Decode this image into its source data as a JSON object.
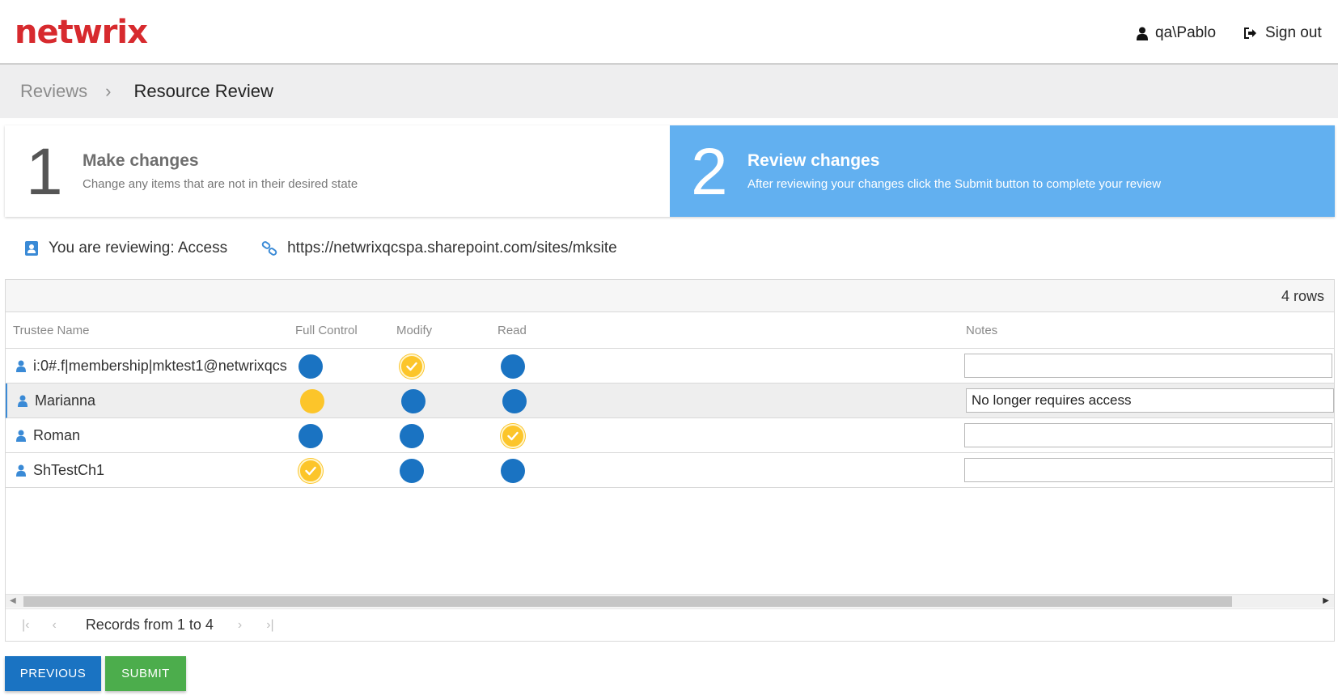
{
  "header": {
    "logo": "netwrix",
    "user": "qa\\Pablo",
    "signout": "Sign out"
  },
  "breadcrumb": {
    "parent": "Reviews",
    "current": "Resource Review"
  },
  "steps": [
    {
      "number": "1",
      "title": "Make changes",
      "description": "Change any items that are not in their desired state",
      "active": false
    },
    {
      "number": "2",
      "title": "Review changes",
      "description": "After reviewing your changes click the Submit button to complete your review",
      "active": true
    }
  ],
  "reviewing": {
    "label": "You are reviewing: Access",
    "url": "https://netwrixqcspa.sharepoint.com/sites/mksite"
  },
  "grid": {
    "rows_count": "4 rows",
    "columns": {
      "trustee": "Trustee Name",
      "full_control": "Full Control",
      "modify": "Modify",
      "read": "Read",
      "notes": "Notes"
    },
    "rows": [
      {
        "name": "i:0#.f|membership|mktest1@netwrixqcs",
        "full_control": "blue",
        "modify": "yellow-check",
        "read": "blue",
        "note": ""
      },
      {
        "name": "Marianna",
        "full_control": "yellow",
        "modify": "blue",
        "read": "blue",
        "note": "No longer requires access"
      },
      {
        "name": "Roman",
        "full_control": "blue",
        "modify": "blue",
        "read": "yellow-check",
        "note": ""
      },
      {
        "name": "ShTestCh1",
        "full_control": "yellow-check",
        "modify": "blue",
        "read": "blue",
        "note": ""
      }
    ],
    "pager": "Records from 1 to 4"
  },
  "buttons": {
    "previous": "PREVIOUS",
    "submit": "SUBMIT"
  },
  "colors": {
    "brand": "#d72a2e",
    "blue": "#1a73c2",
    "yellow": "#fcc52a",
    "active_step": "#62b0f0",
    "submit": "#4cad4c"
  }
}
